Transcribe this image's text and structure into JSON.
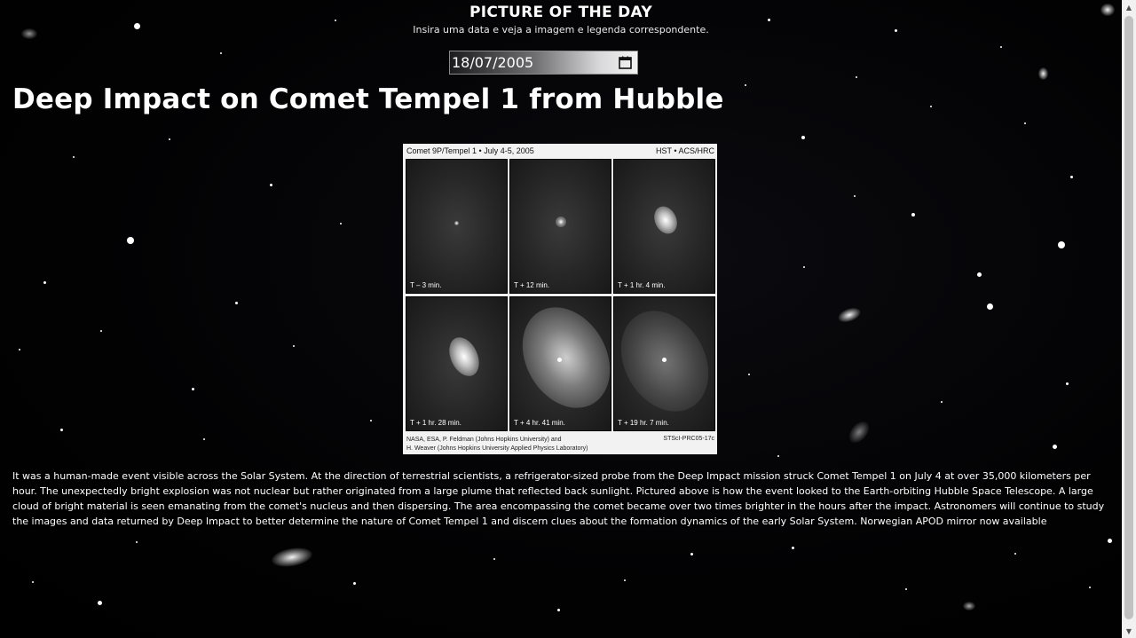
{
  "header": {
    "title": "PICTURE OF THE DAY",
    "subtitle": "Insira uma data e veja a imagem e legenda correspondente."
  },
  "date_picker": {
    "value": "18/07/2005",
    "icon": "calendar-icon"
  },
  "apod": {
    "title": "Deep Impact on Comet Tempel 1 from Hubble",
    "image": {
      "header_left": "Comet 9P/Tempel 1 • July 4-5, 2005",
      "header_right": "HST • ACS/HRC",
      "frames": [
        {
          "label": "T – 3 min."
        },
        {
          "label": "T + 12 min."
        },
        {
          "label": "T + 1 hr. 4 min."
        },
        {
          "label": "T + 1 hr. 28 min."
        },
        {
          "label": "T + 4 hr. 41 min."
        },
        {
          "label": "T + 19 hr. 7 min."
        }
      ],
      "credit_line1": "NASA, ESA, P. Feldman (Johns Hopkins University) and",
      "credit_line2": "H. Weaver (Johns Hopkins University Applied Physics Laboratory)",
      "credit_right": "STScI-PRC05-17c"
    },
    "explanation": "It was a human-made event visible across the Solar System. At the direction of terrestrial scientists, a refrigerator-sized probe from the Deep Impact mission struck Comet Tempel 1 on July 4 at over 35,000 kilometers per hour. The unexpectedly bright explosion was not nuclear but rather originated from a large plume that reflected back sunlight. Pictured above is how the event looked to the Earth-orbiting Hubble Space Telescope. A large cloud of bright material is seen emanating from the comet's nucleus and then dispersing. The area encompassing the comet became over two times brighter in the hours after the impact. Astronomers will continue to study the images and data returned by Deep Impact to better determine the nature of Comet Tempel 1 and discern clues about the formation dynamics of the early Solar System. Norwegian APOD mirror now available"
  },
  "colors": {
    "background": "#000000",
    "text": "#ffffff",
    "scrollbar_track": "#f1f1f1",
    "scrollbar_thumb": "#c1c1c1"
  }
}
